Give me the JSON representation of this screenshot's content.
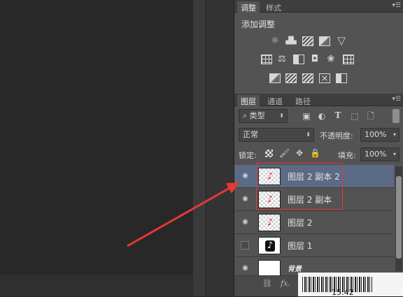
{
  "adjustments_panel": {
    "tabs": [
      {
        "label": "调整",
        "active": true
      },
      {
        "label": "样式",
        "active": false
      }
    ],
    "title": "添加调整",
    "icon_rows": [
      [
        "brightness-contrast-icon",
        "levels-icon",
        "curves-icon",
        "exposure-icon",
        "vibrance-icon"
      ],
      [
        "hue-saturation-icon",
        "color-balance-icon",
        "black-white-icon",
        "photo-filter-icon",
        "channel-mixer-icon",
        "color-lookup-icon"
      ],
      [
        "invert-icon",
        "posterize-icon",
        "threshold-icon",
        "gradient-map-icon",
        "selective-color-icon"
      ]
    ]
  },
  "layers_panel": {
    "tabs": [
      {
        "label": "图层",
        "active": true
      },
      {
        "label": "通道",
        "active": false
      },
      {
        "label": "路径",
        "active": false
      }
    ],
    "filter_kind": "类型",
    "blend_mode": "正常",
    "opacity_label": "不透明度:",
    "opacity_value": "100%",
    "lock_label": "锁定:",
    "fill_label": "填充:",
    "fill_value": "100%",
    "layers": [
      {
        "name": "图层 2 副本 2",
        "visible": true,
        "selected": true,
        "thumb": "transparent"
      },
      {
        "name": "图层 2 副本",
        "visible": true,
        "selected": false,
        "thumb": "transparent"
      },
      {
        "name": "图层 2",
        "visible": true,
        "selected": false,
        "thumb": "transparent"
      },
      {
        "name": "图层 1",
        "visible": false,
        "selected": false,
        "thumb": "dark-logo"
      },
      {
        "name": "背景",
        "visible": true,
        "selected": false,
        "thumb": "white"
      }
    ],
    "footer_icons": [
      "link-icon",
      "fx-icon"
    ]
  },
  "taskbar": {
    "clock": "15:42"
  },
  "annotation": {
    "color": "#e53935"
  }
}
